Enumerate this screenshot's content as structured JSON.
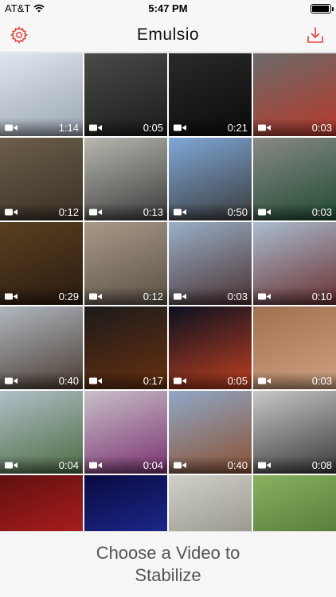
{
  "status_bar": {
    "carrier": "AT&T",
    "time": "5:47 PM",
    "battery_percent": 95
  },
  "nav": {
    "title": "Emulsio",
    "settings_icon": "gear-icon",
    "import_icon": "download-icon",
    "accent_color": "#e8413d"
  },
  "videos": [
    {
      "duration": "1:14",
      "c1": "#dfe6ee",
      "c2": "#9aa5b1"
    },
    {
      "duration": "0:05",
      "c1": "#4a4a48",
      "c2": "#1b1b1b"
    },
    {
      "duration": "0:21",
      "c1": "#2a2a2a",
      "c2": "#0a0a0a"
    },
    {
      "duration": "0:03",
      "c1": "#6a6a6a",
      "c2": "#b83a2a"
    },
    {
      "duration": "0:12",
      "c1": "#6b5f4a",
      "c2": "#3a3025"
    },
    {
      "duration": "0:13",
      "c1": "#b8b8b0",
      "c2": "#3a3a3a"
    },
    {
      "duration": "0:50",
      "c1": "#7fa8d8",
      "c2": "#3a3a3a"
    },
    {
      "duration": "0:03",
      "c1": "#8a8a86",
      "c2": "#1f4a32"
    },
    {
      "duration": "0:29",
      "c1": "#5a4020",
      "c2": "#2a1a10"
    },
    {
      "duration": "0:12",
      "c1": "#a89a88",
      "c2": "#5a5045"
    },
    {
      "duration": "0:03",
      "c1": "#9ab0c8",
      "c2": "#4a3030"
    },
    {
      "duration": "0:10",
      "c1": "#aabdd0",
      "c2": "#6a3030"
    },
    {
      "duration": "0:40",
      "c1": "#b0b8c0",
      "c2": "#4a3a30"
    },
    {
      "duration": "0:17",
      "c1": "#1a1a1a",
      "c2": "#6a3010"
    },
    {
      "duration": "0:05",
      "c1": "#0a1020",
      "c2": "#c04020"
    },
    {
      "duration": "0:03",
      "c1": "#a07050",
      "c2": "#d0a080"
    },
    {
      "duration": "0:04",
      "c1": "#b0c0c8",
      "c2": "#4a6a40"
    },
    {
      "duration": "0:04",
      "c1": "#c8c0c8",
      "c2": "#7a3070"
    },
    {
      "duration": "0:40",
      "c1": "#90a8c8",
      "c2": "#8a5030"
    },
    {
      "duration": "0:08",
      "c1": "#c8c8c8",
      "c2": "#3a3a3a"
    },
    {
      "duration": "",
      "c1": "#601010",
      "c2": "#c02020"
    },
    {
      "duration": "",
      "c1": "#0a0a40",
      "c2": "#2030a0"
    },
    {
      "duration": "",
      "c1": "#d0d0c8",
      "c2": "#8a8a80"
    },
    {
      "duration": "",
      "c1": "#8ab060",
      "c2": "#4a7030"
    }
  ],
  "prompt": "Choose a Video to Stabilize"
}
